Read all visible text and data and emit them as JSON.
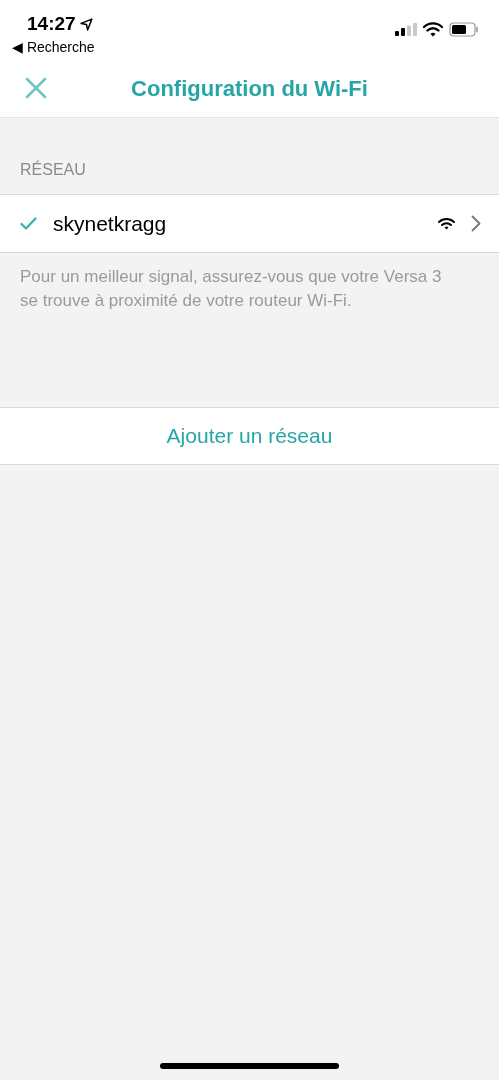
{
  "status_bar": {
    "time": "14:27",
    "back_label": "◀ Recherche"
  },
  "header": {
    "title": "Configuration du Wi-Fi"
  },
  "section": {
    "heading": "RÉSEAU"
  },
  "networks": [
    {
      "name": "skynetkragg",
      "selected": true
    }
  ],
  "hint": "Pour un meilleur signal, assurez-vous que votre Versa 3 se trouve à proximité de votre routeur Wi-Fi.",
  "add_button": "Ajouter un réseau"
}
